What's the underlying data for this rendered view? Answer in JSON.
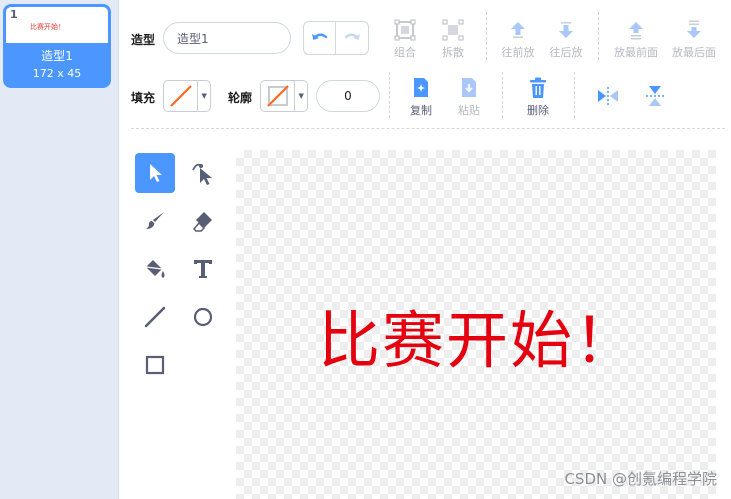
{
  "costume_list": {
    "items": [
      {
        "number": "1",
        "thumbnail_text": "比赛开始！",
        "name": "造型1",
        "size": "172 x 45"
      }
    ]
  },
  "toolbar": {
    "costume_label": "造型",
    "costume_name_value": "造型1",
    "group_label": "组合",
    "ungroup_label": "拆散",
    "forward_label": "往前放",
    "backward_label": "往后放",
    "front_label": "放最前面",
    "back_label": "放最后面",
    "fill_label": "填充",
    "outline_label": "轮廓",
    "outline_width_value": "0",
    "copy_label": "复制",
    "paste_label": "粘贴",
    "delete_label": "删除"
  },
  "tools": [
    "select",
    "reshape",
    "brush",
    "eraser",
    "fill",
    "text",
    "line",
    "circle",
    "rectangle"
  ],
  "canvas": {
    "text": "比赛开始！"
  },
  "colors": {
    "accent": "#4c97ff",
    "canvas_text": "#e4000f",
    "fill_swatch_line": "#ff6a20",
    "disabled": "#b4b8c1"
  },
  "watermark": "CSDN @创氪编程学院"
}
